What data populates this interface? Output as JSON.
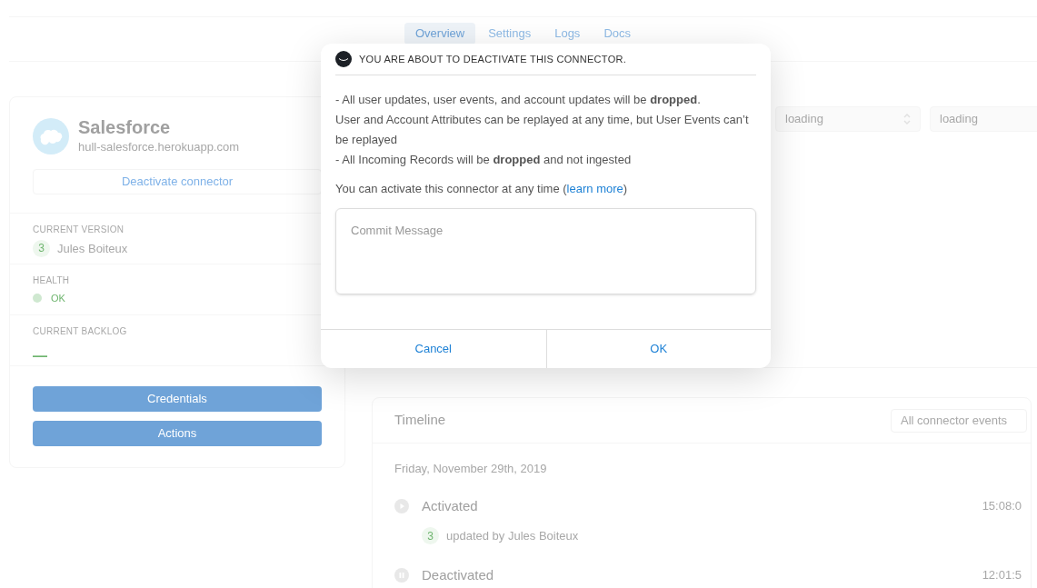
{
  "tabs": [
    {
      "label": "Overview",
      "selected": true
    },
    {
      "label": "Settings",
      "selected": false
    },
    {
      "label": "Logs",
      "selected": false
    },
    {
      "label": "Docs",
      "selected": false
    }
  ],
  "connector": {
    "name": "Salesforce",
    "url": "hull-salesforce.herokuapp.com",
    "deactivate": "Deactivate connector",
    "sections": [
      {
        "kind": "version",
        "label": "CURRENT VERSION",
        "badge": "3",
        "value": "Jules Boiteux"
      },
      {
        "kind": "status",
        "label": "HEALTH",
        "value": "OK",
        "color": "#cfe8d0"
      },
      {
        "kind": "plain",
        "label": "CURRENT BACKLOG",
        "value": "—"
      }
    ],
    "buttons": [
      "Credentials",
      "Actions"
    ]
  },
  "selects": [
    {
      "value": "loading",
      "kind": "select"
    },
    {
      "value": "loading",
      "kind": "input"
    }
  ],
  "timeline": {
    "title": "Timeline",
    "filter": "All connector events",
    "date": "Friday, November 29th, 2019",
    "events": [
      {
        "kind": "play",
        "title": "Activated",
        "time": "15:08:0",
        "badge": "3",
        "detail": "updated by Jules Boiteux"
      },
      {
        "kind": "pause",
        "title": "Deactivated",
        "time": "12:01:5"
      }
    ]
  },
  "dialog": {
    "title": "YOU ARE ABOUT TO DEACTIVATE THIS CONNECTOR.",
    "lines": [
      "- All user updates, user events, and account updates will be **dropped**.",
      "User and Account Attributes can be replayed at any time, but User Events can’t be replayed",
      "- All Incoming Records will be **dropped** and not ingested"
    ],
    "note": "You can activate this connector at any time (",
    "link": "learn more",
    "note_end": ")",
    "placeholder": "Commit Message",
    "buttons": [
      "Cancel",
      "OK"
    ]
  }
}
